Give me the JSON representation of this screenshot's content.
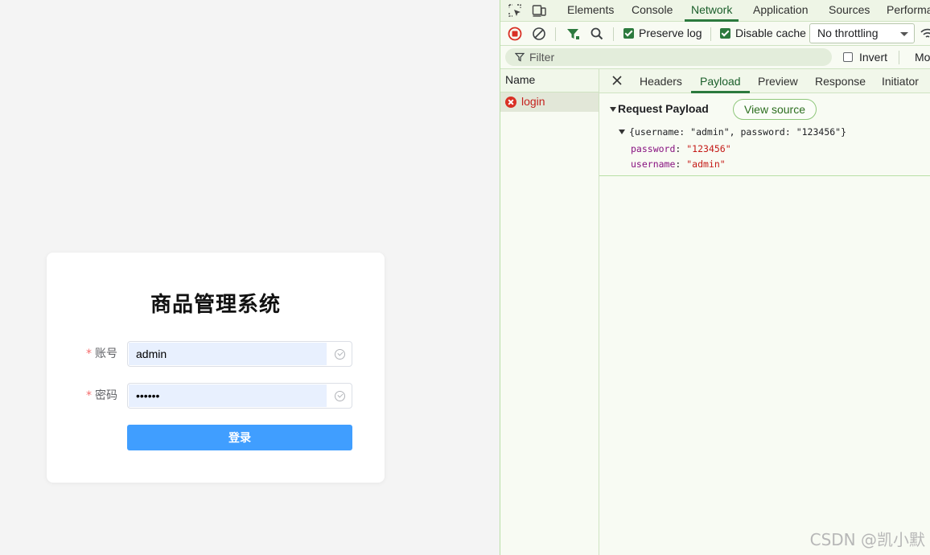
{
  "login": {
    "title": "商品管理系统",
    "required_mark": "*",
    "username_label": "账号",
    "username_value": "admin",
    "password_label": "密码",
    "password_value": "123456",
    "submit_label": "登录"
  },
  "devtools": {
    "tabs": [
      "Elements",
      "Console",
      "Network",
      "Application",
      "Sources",
      "Performa"
    ],
    "active_tab": "Network",
    "toolbar": {
      "preserve_log_label": "Preserve log",
      "preserve_log_checked": true,
      "disable_cache_label": "Disable cache",
      "disable_cache_checked": true,
      "throttling_value": "No throttling"
    },
    "filter": {
      "placeholder": "Filter",
      "invert_label": "Invert",
      "invert_checked": false,
      "more_label": "Mo"
    },
    "requests": {
      "header": "Name",
      "items": [
        {
          "name": "login",
          "status": "error"
        }
      ]
    },
    "detail_tabs": [
      "Headers",
      "Payload",
      "Preview",
      "Response",
      "Initiator"
    ],
    "active_detail_tab": "Payload",
    "payload": {
      "title": "Request Payload",
      "view_source_label": "View source",
      "summary": "{username: \"admin\", password: \"123456\"}",
      "properties": [
        {
          "key": "password",
          "value": "\"123456\""
        },
        {
          "key": "username",
          "value": "\"admin\""
        }
      ]
    },
    "colors": {
      "accent": "#2c7a3e",
      "error": "#d93025",
      "primary_button": "#409eff"
    }
  },
  "watermark": "CSDN @凯小默"
}
